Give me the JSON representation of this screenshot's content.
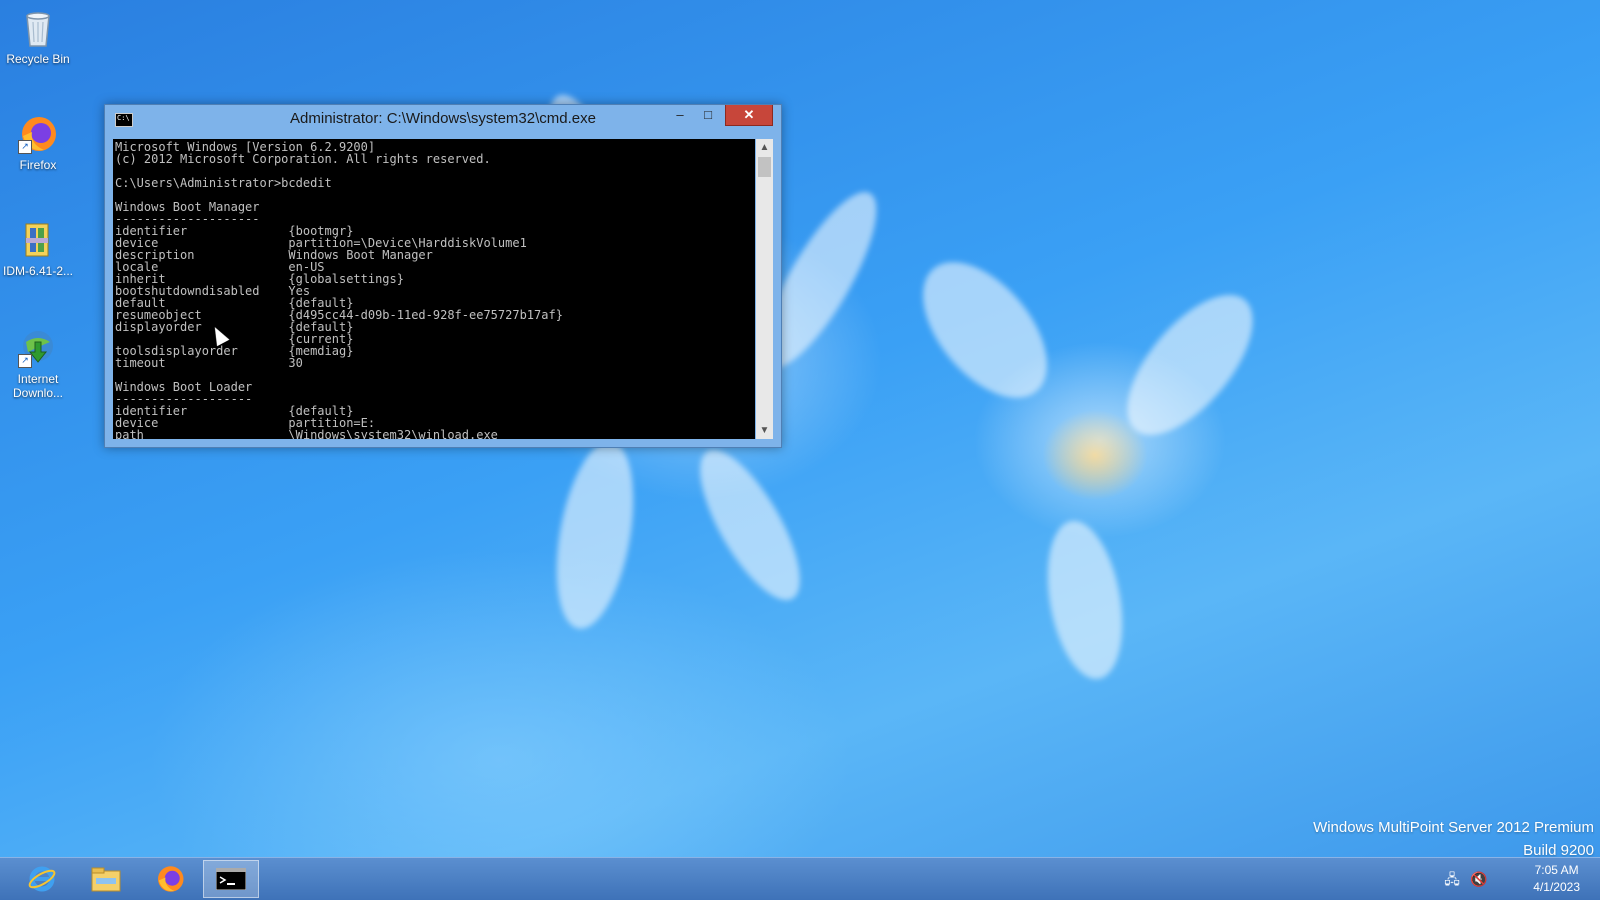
{
  "desktop": {
    "icons": [
      {
        "label": "Recycle Bin",
        "icon": "recycle-bin-icon"
      },
      {
        "label": "Firefox",
        "icon": "firefox-icon"
      },
      {
        "label": "IDM-6.41-2...",
        "icon": "winrar-archive-icon"
      },
      {
        "label": "Internet Downlo...",
        "icon": "idm-icon"
      }
    ]
  },
  "cmd_window": {
    "title": "Administrator: C:\\Windows\\system32\\cmd.exe",
    "minimize_label": "–",
    "maximize_label": "□",
    "close_label": "✕",
    "console_text": "Microsoft Windows [Version 6.2.9200]\n(c) 2012 Microsoft Corporation. All rights reserved.\n\nC:\\Users\\Administrator>bcdedit\n\nWindows Boot Manager\n--------------------\nidentifier              {bootmgr}\ndevice                  partition=\\Device\\HarddiskVolume1\ndescription             Windows Boot Manager\nlocale                  en-US\ninherit                 {globalsettings}\nbootshutdowndisabled    Yes\ndefault                 {default}\nresumeobject            {d495cc44-d09b-11ed-928f-ee75727b17af}\ndisplayorder            {default}\n                        {current}\ntoolsdisplayorder       {memdiag}\ntimeout                 30\n\nWindows Boot Loader\n-------------------\nidentifier              {default}\ndevice                  partition=E:\npath                    \\Windows\\system32\\winload.exe"
  },
  "watermark": {
    "line1": "Windows MultiPoint Server 2012 Premium",
    "line2": "Build 9200"
  },
  "taskbar": {
    "apps": [
      {
        "name": "Internet Explorer",
        "icon": "internet-explorer-icon",
        "active": false
      },
      {
        "name": "File Explorer",
        "icon": "file-explorer-icon",
        "active": false
      },
      {
        "name": "Firefox",
        "icon": "firefox-icon",
        "active": false
      },
      {
        "name": "Command Prompt",
        "icon": "command-prompt-icon",
        "active": true
      }
    ],
    "tray": [
      {
        "icon": "network-icon"
      },
      {
        "icon": "volume-muted-icon"
      }
    ],
    "clock": {
      "time": "7:05 AM",
      "date": "4/1/2023"
    }
  },
  "colors": {
    "console_bg": "#000000",
    "console_text": "#c0c0c0",
    "title_bar": "#7eb3ea",
    "close_button": "#c7463a",
    "taskbar": "#4a80c4"
  }
}
